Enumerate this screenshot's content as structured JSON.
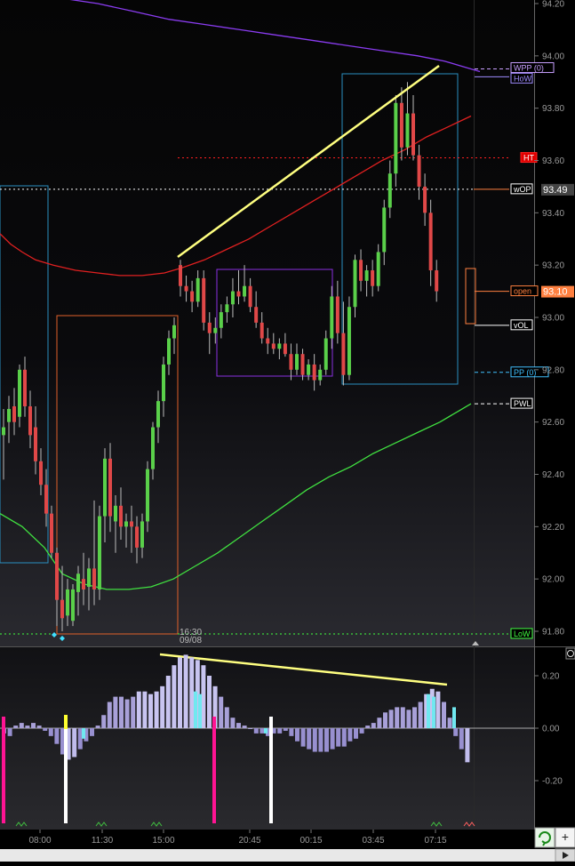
{
  "chart_data": [
    {
      "type": "candlestick",
      "panel": "price",
      "ylim": [
        91.74,
        94.22
      ],
      "y_ticks": [
        "94.20",
        "94.00",
        "93.80",
        "93.60",
        "93.40",
        "93.20",
        "93.00",
        "92.80",
        "92.60",
        "92.40",
        "92.20",
        "92.00",
        "91.80"
      ],
      "x_ticks": [
        "08:00",
        "11:30",
        "15:00",
        "20:45",
        "00:15",
        "03:45",
        "07:15"
      ],
      "annotations": {
        "session_start_label": "16:30",
        "session_date_label": "09/08"
      },
      "levels": [
        {
          "label": "WPP (0)",
          "value": 93.95,
          "color": "#c8a0ff",
          "style": "dashed"
        },
        {
          "label": "HoW",
          "value": 93.92,
          "color": "#9f8cff",
          "style": "solid"
        },
        {
          "label": "HT",
          "value": 93.61,
          "color": "#ff2020",
          "style": "dotted"
        },
        {
          "label": "wOP",
          "value": 93.49,
          "color": "#ffffff",
          "style": "dotted",
          "value_label": "93.49"
        },
        {
          "label": "open",
          "value": 93.1,
          "color": "#ff8040",
          "style": "solid",
          "value_label": "93.10"
        },
        {
          "label": "vOL",
          "value": 92.97,
          "color": "#ffffff",
          "style": "solid"
        },
        {
          "label": "PP (0)",
          "value": 92.79,
          "color": "#40c0ff",
          "style": "dashed"
        },
        {
          "label": "PWL",
          "value": 92.67,
          "color": "#ffffff",
          "style": "dashed"
        },
        {
          "label": "LoW",
          "value": 91.79,
          "color": "#40ff40",
          "style": "dotted"
        }
      ],
      "series": [
        {
          "name": "",
          "kind": "candles",
          "candles": [
            {
              "o": 92.55,
              "h": 92.65,
              "l": 92.38,
              "c": 92.58
            },
            {
              "o": 92.6,
              "h": 92.7,
              "l": 92.52,
              "c": 92.65
            },
            {
              "o": 92.66,
              "h": 92.73,
              "l": 92.55,
              "c": 92.6
            },
            {
              "o": 92.62,
              "h": 92.82,
              "l": 92.58,
              "c": 92.8
            },
            {
              "o": 92.8,
              "h": 92.85,
              "l": 92.62,
              "c": 92.66
            },
            {
              "o": 92.66,
              "h": 92.72,
              "l": 92.5,
              "c": 92.55
            },
            {
              "o": 92.58,
              "h": 92.66,
              "l": 92.4,
              "c": 92.45
            },
            {
              "o": 92.45,
              "h": 92.5,
              "l": 92.32,
              "c": 92.36
            },
            {
              "o": 92.36,
              "h": 92.42,
              "l": 92.2,
              "c": 92.25
            },
            {
              "o": 92.25,
              "h": 92.28,
              "l": 92.08,
              "c": 92.1
            },
            {
              "o": 92.1,
              "h": 92.12,
              "l": 91.82,
              "c": 91.92
            },
            {
              "o": 91.92,
              "h": 92.05,
              "l": 91.8,
              "c": 91.85
            },
            {
              "o": 91.86,
              "h": 92.0,
              "l": 91.82,
              "c": 91.96
            },
            {
              "o": 91.84,
              "h": 91.98,
              "l": 91.82,
              "c": 91.96
            },
            {
              "o": 91.95,
              "h": 92.05,
              "l": 91.86,
              "c": 92.02
            },
            {
              "o": 92.0,
              "h": 92.1,
              "l": 91.9,
              "c": 91.96
            },
            {
              "o": 91.97,
              "h": 92.08,
              "l": 91.88,
              "c": 92.04
            },
            {
              "o": 92.04,
              "h": 92.3,
              "l": 91.9,
              "c": 91.96
            },
            {
              "o": 91.96,
              "h": 92.28,
              "l": 91.92,
              "c": 92.24
            },
            {
              "o": 92.24,
              "h": 92.5,
              "l": 92.14,
              "c": 92.46
            },
            {
              "o": 92.46,
              "h": 92.52,
              "l": 92.18,
              "c": 92.24
            },
            {
              "o": 92.22,
              "h": 92.32,
              "l": 92.1,
              "c": 92.28
            },
            {
              "o": 92.28,
              "h": 92.35,
              "l": 92.15,
              "c": 92.2
            },
            {
              "o": 92.2,
              "h": 92.25,
              "l": 92.12,
              "c": 92.22
            },
            {
              "o": 92.22,
              "h": 92.28,
              "l": 92.1,
              "c": 92.2
            },
            {
              "o": 92.2,
              "h": 92.24,
              "l": 92.06,
              "c": 92.12
            },
            {
              "o": 92.12,
              "h": 92.25,
              "l": 92.08,
              "c": 92.22
            },
            {
              "o": 92.22,
              "h": 92.45,
              "l": 92.18,
              "c": 92.42
            },
            {
              "o": 92.42,
              "h": 92.6,
              "l": 92.38,
              "c": 92.58
            },
            {
              "o": 92.58,
              "h": 92.72,
              "l": 92.52,
              "c": 92.68
            },
            {
              "o": 92.68,
              "h": 92.85,
              "l": 92.62,
              "c": 92.82
            },
            {
              "o": 92.82,
              "h": 92.95,
              "l": 92.78,
              "c": 92.92
            },
            {
              "o": 92.92,
              "h": 93.0,
              "l": 92.86,
              "c": 92.97
            },
            {
              "o": 93.2,
              "h": 93.22,
              "l": 93.08,
              "c": 93.12
            },
            {
              "o": 93.12,
              "h": 93.16,
              "l": 93.06,
              "c": 93.1
            },
            {
              "o": 93.1,
              "h": 93.14,
              "l": 93.02,
              "c": 93.06
            },
            {
              "o": 93.06,
              "h": 93.18,
              "l": 93.04,
              "c": 93.15
            },
            {
              "o": 93.15,
              "h": 93.18,
              "l": 92.95,
              "c": 92.98
            },
            {
              "o": 92.98,
              "h": 93.02,
              "l": 92.86,
              "c": 92.94
            },
            {
              "o": 92.94,
              "h": 93.0,
              "l": 92.9,
              "c": 92.96
            },
            {
              "o": 92.96,
              "h": 93.05,
              "l": 92.92,
              "c": 93.02
            },
            {
              "o": 93.02,
              "h": 93.08,
              "l": 92.98,
              "c": 93.05
            },
            {
              "o": 93.05,
              "h": 93.15,
              "l": 93.0,
              "c": 93.1
            },
            {
              "o": 93.1,
              "h": 93.18,
              "l": 93.05,
              "c": 93.08
            },
            {
              "o": 93.08,
              "h": 93.2,
              "l": 93.06,
              "c": 93.12
            },
            {
              "o": 93.12,
              "h": 93.15,
              "l": 93.02,
              "c": 93.04
            },
            {
              "o": 93.04,
              "h": 93.1,
              "l": 92.96,
              "c": 92.98
            },
            {
              "o": 92.98,
              "h": 93.02,
              "l": 92.9,
              "c": 92.92
            },
            {
              "o": 92.92,
              "h": 92.96,
              "l": 92.86,
              "c": 92.9
            },
            {
              "o": 92.9,
              "h": 92.94,
              "l": 92.86,
              "c": 92.88
            },
            {
              "o": 92.88,
              "h": 92.92,
              "l": 92.84,
              "c": 92.9
            },
            {
              "o": 92.9,
              "h": 92.94,
              "l": 92.85,
              "c": 92.86
            },
            {
              "o": 92.86,
              "h": 92.9,
              "l": 92.76,
              "c": 92.8
            },
            {
              "o": 92.8,
              "h": 92.9,
              "l": 92.78,
              "c": 92.86
            },
            {
              "o": 92.86,
              "h": 92.88,
              "l": 92.76,
              "c": 92.78
            },
            {
              "o": 92.78,
              "h": 92.84,
              "l": 92.76,
              "c": 92.82
            },
            {
              "o": 92.82,
              "h": 92.86,
              "l": 92.72,
              "c": 92.76
            },
            {
              "o": 92.76,
              "h": 92.82,
              "l": 92.74,
              "c": 92.8
            },
            {
              "o": 92.8,
              "h": 92.95,
              "l": 92.78,
              "c": 92.92
            },
            {
              "o": 92.92,
              "h": 93.12,
              "l": 92.88,
              "c": 93.08
            },
            {
              "o": 93.08,
              "h": 93.14,
              "l": 92.9,
              "c": 92.94
            },
            {
              "o": 92.94,
              "h": 93.06,
              "l": 92.74,
              "c": 92.78
            },
            {
              "o": 92.78,
              "h": 93.08,
              "l": 92.76,
              "c": 93.04
            },
            {
              "o": 93.04,
              "h": 93.24,
              "l": 93.0,
              "c": 93.22
            },
            {
              "o": 93.22,
              "h": 93.26,
              "l": 93.1,
              "c": 93.14
            },
            {
              "o": 93.14,
              "h": 93.2,
              "l": 93.08,
              "c": 93.18
            },
            {
              "o": 93.18,
              "h": 93.22,
              "l": 93.08,
              "c": 93.12
            },
            {
              "o": 93.12,
              "h": 93.28,
              "l": 93.1,
              "c": 93.25
            },
            {
              "o": 93.25,
              "h": 93.45,
              "l": 93.2,
              "c": 93.42
            },
            {
              "o": 93.42,
              "h": 93.6,
              "l": 93.38,
              "c": 93.55
            },
            {
              "o": 93.55,
              "h": 93.85,
              "l": 93.5,
              "c": 93.82
            },
            {
              "o": 93.82,
              "h": 93.88,
              "l": 93.6,
              "c": 93.65
            },
            {
              "o": 93.65,
              "h": 93.9,
              "l": 93.62,
              "c": 93.78
            },
            {
              "o": 93.78,
              "h": 93.85,
              "l": 93.6,
              "c": 93.62
            },
            {
              "o": 93.62,
              "h": 93.66,
              "l": 93.45,
              "c": 93.5
            },
            {
              "o": 93.5,
              "h": 93.55,
              "l": 93.35,
              "c": 93.4
            },
            {
              "o": 93.4,
              "h": 93.45,
              "l": 93.12,
              "c": 93.18
            },
            {
              "o": 93.18,
              "h": 93.22,
              "l": 93.06,
              "c": 93.1
            }
          ]
        },
        {
          "name": "",
          "kind": "line",
          "color": "#e02020",
          "values": [
            93.32,
            93.28,
            93.25,
            93.22,
            93.2,
            93.18,
            93.17,
            93.16,
            93.16,
            93.17,
            93.19,
            93.22,
            93.26,
            93.3,
            93.35,
            93.4,
            93.45,
            93.5,
            93.55,
            93.6,
            93.64,
            93.69,
            93.73,
            93.77
          ]
        },
        {
          "name": "",
          "kind": "line",
          "color": "#40e040",
          "values": [
            92.25,
            92.2,
            92.12,
            92.02,
            91.98,
            91.96,
            91.96,
            91.97,
            92.0,
            92.05,
            92.1,
            92.16,
            92.22,
            92.28,
            92.34,
            92.39,
            92.43,
            92.48,
            92.52,
            92.56,
            92.6,
            92.64,
            92.67
          ]
        },
        {
          "name": "",
          "kind": "line",
          "color": "#8a3cf0",
          "values": [
            94.22,
            94.2,
            94.17,
            94.14,
            94.12,
            94.1,
            94.08,
            94.06,
            94.04,
            94.02,
            94.0,
            93.98,
            93.96,
            93.94
          ]
        }
      ]
    },
    {
      "type": "bar",
      "panel": "oscillator",
      "ylim": [
        -0.35,
        0.31
      ],
      "y_ticks": [
        "0.20",
        "0.00",
        "-0.20"
      ],
      "values": [
        -0.02,
        -0.03,
        0.01,
        0.02,
        0.01,
        0.02,
        0.01,
        -0.01,
        -0.03,
        -0.06,
        -0.1,
        -0.12,
        -0.11,
        -0.08,
        -0.05,
        -0.03,
        0.01,
        0.05,
        0.1,
        0.12,
        0.12,
        0.11,
        0.12,
        0.14,
        0.14,
        0.13,
        0.14,
        0.16,
        0.2,
        0.24,
        0.27,
        0.28,
        0.27,
        0.26,
        0.24,
        0.2,
        0.16,
        0.12,
        0.08,
        0.04,
        0.02,
        0.01,
        0.0,
        -0.02,
        -0.02,
        -0.03,
        -0.02,
        -0.02,
        -0.01,
        -0.03,
        -0.05,
        -0.07,
        -0.08,
        -0.09,
        -0.09,
        -0.09,
        -0.08,
        -0.07,
        -0.07,
        -0.05,
        -0.04,
        -0.02,
        0.01,
        0.02,
        0.04,
        0.06,
        0.07,
        0.08,
        0.08,
        0.07,
        0.08,
        0.1,
        0.13,
        0.15,
        0.14,
        0.1,
        0.04,
        -0.03,
        -0.08,
        -0.13
      ]
    }
  ]
}
